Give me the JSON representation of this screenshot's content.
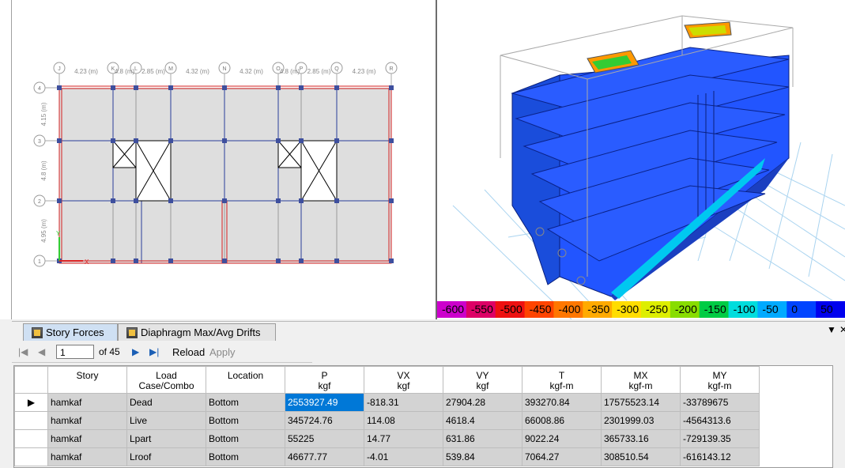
{
  "plan": {
    "dimensions": [
      "4.23 (m)",
      "4.8 (m)",
      "2.85 (m)",
      "4.32 (m)",
      "4.32 (m)",
      "4.8 (m)",
      "2.85 (m)",
      "4.23 (m)"
    ],
    "column_bubbles": [
      "J",
      "K",
      "L",
      "M",
      "N",
      "O",
      "P",
      "Q",
      "R"
    ],
    "row_bubbles": [
      "4",
      "3",
      "2",
      "1"
    ],
    "row_dims": [
      "4.15 (m)",
      "4.8 (m)",
      "4.95 (m)"
    ],
    "axis_y": "Y",
    "axis_x": "X"
  },
  "legend": {
    "values": [
      "-600",
      "-550",
      "-500",
      "-450",
      "-400",
      "-350",
      "-300",
      "-250",
      "-200",
      "-150",
      "-100",
      "-50",
      "0",
      "50"
    ],
    "colors": [
      "#cc00cc",
      "#dd0066",
      "#ee1111",
      "#ff4400",
      "#ff7700",
      "#ffaa00",
      "#ffdd00",
      "#ddee00",
      "#88dd00",
      "#00cc44",
      "#00dddd",
      "#00aaff",
      "#0044ff",
      "#0000ee"
    ]
  },
  "tabs": [
    {
      "label": "Story Forces",
      "active": true
    },
    {
      "label": "Diaphragm Max/Avg Drifts",
      "active": false
    }
  ],
  "tabbar_controls": {
    "dropdown": "▼",
    "close": "✕"
  },
  "toolbar": {
    "first": "|◀",
    "prev": "◀",
    "page": "1",
    "of": "of 45",
    "next": "▶",
    "last": "▶|",
    "reload": "Reload",
    "apply": "Apply"
  },
  "table": {
    "headers": [
      [
        "Story",
        ""
      ],
      [
        "Load",
        "Case/Combo"
      ],
      [
        "Location",
        ""
      ],
      [
        "P",
        "kgf"
      ],
      [
        "VX",
        "kgf"
      ],
      [
        "VY",
        "kgf"
      ],
      [
        "T",
        "kgf-m"
      ],
      [
        "MX",
        "kgf-m"
      ],
      [
        "MY",
        "kgf-m"
      ]
    ],
    "rows": [
      [
        "hamkaf",
        "Dead",
        "Bottom",
        "2553927.49",
        "-818.31",
        "27904.28",
        "393270.84",
        "17575523.14",
        "-33789675"
      ],
      [
        "hamkaf",
        "Live",
        "Bottom",
        "345724.76",
        "114.08",
        "4618.4",
        "66008.86",
        "2301999.03",
        "-4564313.6"
      ],
      [
        "hamkaf",
        "Lpart",
        "Bottom",
        "55225",
        "14.77",
        "631.86",
        "9022.24",
        "365733.16",
        "-729139.35"
      ],
      [
        "hamkaf",
        "Lroof",
        "Bottom",
        "46677.77",
        "-4.01",
        "539.84",
        "7064.27",
        "308510.54",
        "-616143.12"
      ]
    ],
    "row_marker": "▶"
  }
}
